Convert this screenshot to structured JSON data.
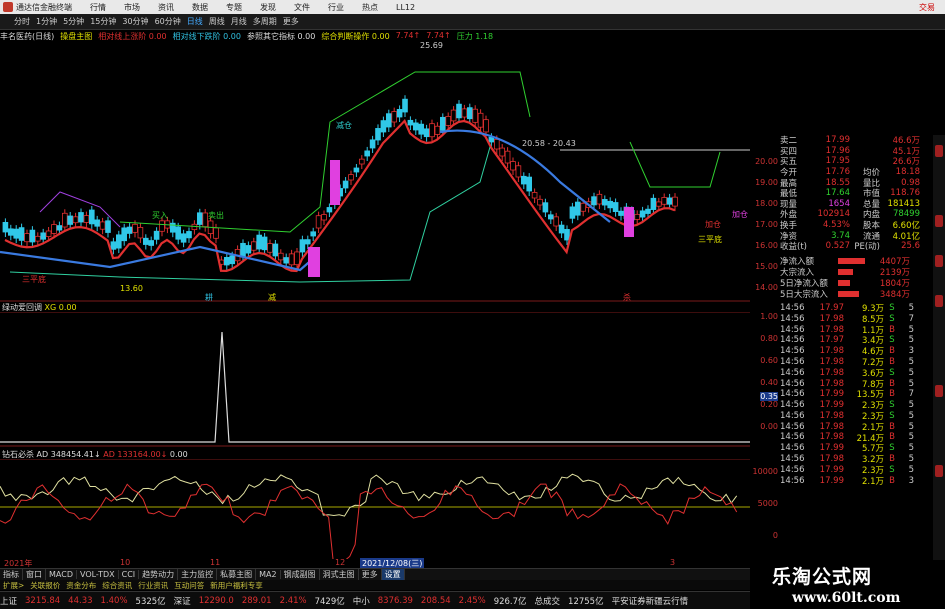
{
  "titlebar": {
    "app_name": "通达信金融终端",
    "menu": [
      "行情",
      "市场",
      "资讯",
      "数据",
      "专题",
      "发现",
      "文件",
      "行业",
      "热点",
      "LL12"
    ],
    "trade": "交易"
  },
  "toolbar": {
    "items": [
      "分时",
      "1分钟",
      "5分钟",
      "15分钟",
      "30分钟",
      "60分钟",
      "日线",
      "周线",
      "月线",
      "多周期",
      "更多"
    ],
    "active": "日线"
  },
  "indicator_line": {
    "stock": "丰名医药(日线)",
    "main": "操盘主图",
    "items": [
      {
        "text": "相对线上涨阶 0.00",
        "color": "#e03030"
      },
      {
        "text": "相对线下跌阶 0.00",
        "color": "#30c0e0"
      },
      {
        "text": "参照其它指标 0.00",
        "color": "#ddd"
      },
      {
        "text": "综合判断操作 0.00",
        "color": "#e0e000"
      },
      {
        "text": "7.74↑",
        "color": "#e03030"
      },
      {
        "text": "7.74↑",
        "color": "#e03030"
      },
      {
        "text": "压力 1.18",
        "color": "#30d030"
      }
    ]
  },
  "price_axis": [
    "20.00",
    "19.00",
    "18.00",
    "17.00",
    "16.00",
    "15.00",
    "14.00"
  ],
  "annotations": {
    "high": "25.69",
    "low": "13.60",
    "box": "20.58 - 20.43",
    "labels": [
      "三平底",
      "三平底",
      "加仓",
      "加仓",
      "减仓",
      "买入",
      "卖出",
      "耕",
      "减",
      "杀"
    ]
  },
  "sub1": {
    "name": "绿动爱回调",
    "param": "XG 0.00",
    "axis": [
      "1.00",
      "0.80",
      "0.60",
      "0.40",
      "0.20",
      "0.00"
    ],
    "cursor_val": "0.35"
  },
  "sub2": {
    "name": "钻石必杀",
    "ad_label": "AD 348454.41↓",
    "ad2_label": "AD 133164.00↓",
    "v0": "0.00",
    "axis": [
      "10000",
      "5000",
      "0"
    ]
  },
  "dates": [
    "2021年",
    "10",
    "11",
    "12",
    "2021/12/08(三)",
    "3"
  ],
  "quote": {
    "rows": [
      {
        "lab": "卖二",
        "val": "17.99",
        "val2": "46.6万"
      },
      {
        "lab": "买四",
        "val": "17.96",
        "val2": "45.1万"
      },
      {
        "lab": "买五",
        "val": "17.95",
        "val2": "26.6万"
      },
      {
        "lab": "今开",
        "val": "17.76",
        "lab2": "均价",
        "val2": "18.18"
      },
      {
        "lab": "最高",
        "val": "18.55",
        "lab2": "量比",
        "val2": "0.98"
      },
      {
        "lab": "最低",
        "val": "17.64",
        "lab2": "市值",
        "val2": "118.76"
      },
      {
        "lab": "现量",
        "val": "1654",
        "lab2": "总量",
        "val2": "181413"
      },
      {
        "lab": "外盘",
        "val": "102914",
        "lab2": "内盘",
        "val2": "78499"
      },
      {
        "lab": "换手",
        "val": "4.53%",
        "lab2": "股本",
        "val2": "6.60亿"
      },
      {
        "lab": "净资",
        "val": "3.74",
        "lab2": "流通",
        "val2": "4.01亿"
      },
      {
        "lab": "收益(t)",
        "val": "0.527",
        "lab2": "PE(动)",
        "val2": "25.6"
      }
    ],
    "flows": [
      {
        "lab": "净流入额",
        "val": "4407万",
        "frac": 0.9
      },
      {
        "lab": "大宗流入",
        "val": "2139万",
        "frac": 0.5
      },
      {
        "lab": "5日净流入额",
        "val": "1804万",
        "frac": 0.4
      },
      {
        "lab": "5日大宗流入",
        "val": "3484万",
        "frac": 0.7
      }
    ],
    "ticks": [
      {
        "t": "14:56",
        "p": "17.97",
        "v": "9.3万",
        "d": "S",
        "n": "5"
      },
      {
        "t": "14:56",
        "p": "17.98",
        "v": "8.5万",
        "d": "S",
        "n": "7"
      },
      {
        "t": "14:56",
        "p": "17.98",
        "v": "1.1万",
        "d": "B",
        "n": "5"
      },
      {
        "t": "14:56",
        "p": "17.97",
        "v": "3.4万",
        "d": "S",
        "n": "5"
      },
      {
        "t": "14:56",
        "p": "17.98",
        "v": "4.6万",
        "d": "B",
        "n": "3"
      },
      {
        "t": "14:56",
        "p": "17.98",
        "v": "7.2万",
        "d": "B",
        "n": "5"
      },
      {
        "t": "14:56",
        "p": "17.98",
        "v": "3.6万",
        "d": "S",
        "n": "5"
      },
      {
        "t": "14:56",
        "p": "17.98",
        "v": "7.8万",
        "d": "B",
        "n": "5"
      },
      {
        "t": "14:56",
        "p": "17.99",
        "v": "13.5万",
        "d": "B",
        "n": "7"
      },
      {
        "t": "14:56",
        "p": "17.99",
        "v": "2.3万",
        "d": "S",
        "n": "5"
      },
      {
        "t": "14:56",
        "p": "17.98",
        "v": "2.3万",
        "d": "S",
        "n": "5"
      },
      {
        "t": "14:56",
        "p": "17.98",
        "v": "2.1万",
        "d": "B",
        "n": "5"
      },
      {
        "t": "14:56",
        "p": "17.98",
        "v": "21.4万",
        "d": "B",
        "n": "5"
      },
      {
        "t": "14:56",
        "p": "17.99",
        "v": "5.7万",
        "d": "S",
        "n": "5"
      },
      {
        "t": "14:56",
        "p": "17.98",
        "v": "3.2万",
        "d": "B",
        "n": "5"
      },
      {
        "t": "14:56",
        "p": "17.99",
        "v": "2.3万",
        "d": "S",
        "n": "5"
      },
      {
        "t": "14:56",
        "p": "17.99",
        "v": "2.1万",
        "d": "B",
        "n": "3"
      }
    ]
  },
  "bottom_tabs": [
    "指标",
    "窗口",
    "MACD",
    "VOL-TDX",
    "CCI",
    "趋势动力",
    "主力监控",
    "私募主图",
    "MA2",
    "钢成副图",
    "洞式主图",
    "更多",
    "设置"
  ],
  "bottom_tab_active": "设置",
  "bottom_links": [
    "扩展>",
    "关联报价",
    "资金分布",
    "综合资讯",
    "行业资讯",
    "互动问答",
    "新用户福利专享"
  ],
  "status": [
    {
      "text": "上证",
      "color": "#ddd"
    },
    {
      "text": "3215.84",
      "color": "#e03030"
    },
    {
      "text": "44.33",
      "color": "#e03030"
    },
    {
      "text": "1.40%",
      "color": "#e03030"
    },
    {
      "text": "5325亿",
      "color": "#ddd"
    },
    {
      "text": "深证",
      "color": "#ddd"
    },
    {
      "text": "12290.0",
      "color": "#e03030"
    },
    {
      "text": "289.01",
      "color": "#e03030"
    },
    {
      "text": "2.41%",
      "color": "#e03030"
    },
    {
      "text": "7429亿",
      "color": "#ddd"
    },
    {
      "text": "中小",
      "color": "#ddd"
    },
    {
      "text": "8376.39",
      "color": "#e03030"
    },
    {
      "text": "208.54",
      "color": "#e03030"
    },
    {
      "text": "2.45%",
      "color": "#e03030"
    },
    {
      "text": "926.7亿",
      "color": "#ddd"
    },
    {
      "text": "总成交",
      "color": "#ddd"
    },
    {
      "text": "12755亿",
      "color": "#ddd"
    },
    {
      "text": "平安证券新疆云行情",
      "color": "#ddd"
    }
  ],
  "watermark": {
    "line1": "乐淘公式网",
    "line2": "www.60lt.com"
  }
}
